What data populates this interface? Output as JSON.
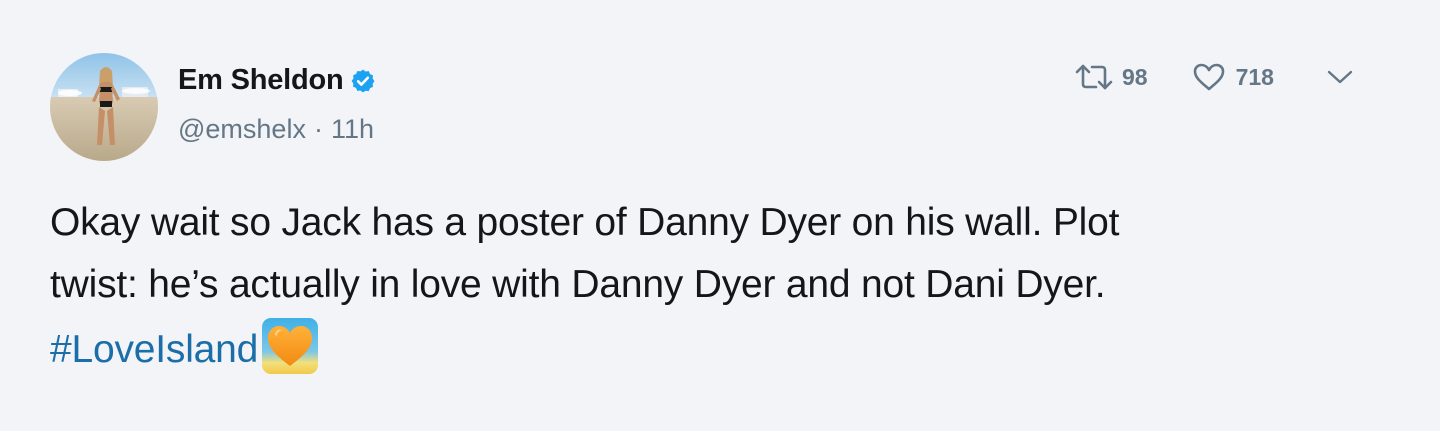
{
  "user": {
    "name": "Em Sheldon",
    "handle": "@emshelx",
    "separator": "·",
    "time": "11h"
  },
  "actions": {
    "retweet_count": "98",
    "like_count": "718"
  },
  "tweet": {
    "line1": "Okay wait so Jack has a poster of Danny Dyer on his wall. Plot",
    "line2": "twist: he’s actually in love with Danny Dyer and not Dani Dyer.",
    "hashtag": "#LoveIsland"
  },
  "icons": {
    "verified": "verified-badge-icon",
    "retweet": "retweet-icon",
    "like": "heart-outline-icon",
    "caret": "chevron-down-icon",
    "emoji": "orange-heart-sunset-icon"
  },
  "colors": {
    "background": "#f2f4f7",
    "text": "#14171a",
    "secondary": "#657786",
    "hashtag": "#1b6ea8",
    "verified": "#1da1f2"
  }
}
